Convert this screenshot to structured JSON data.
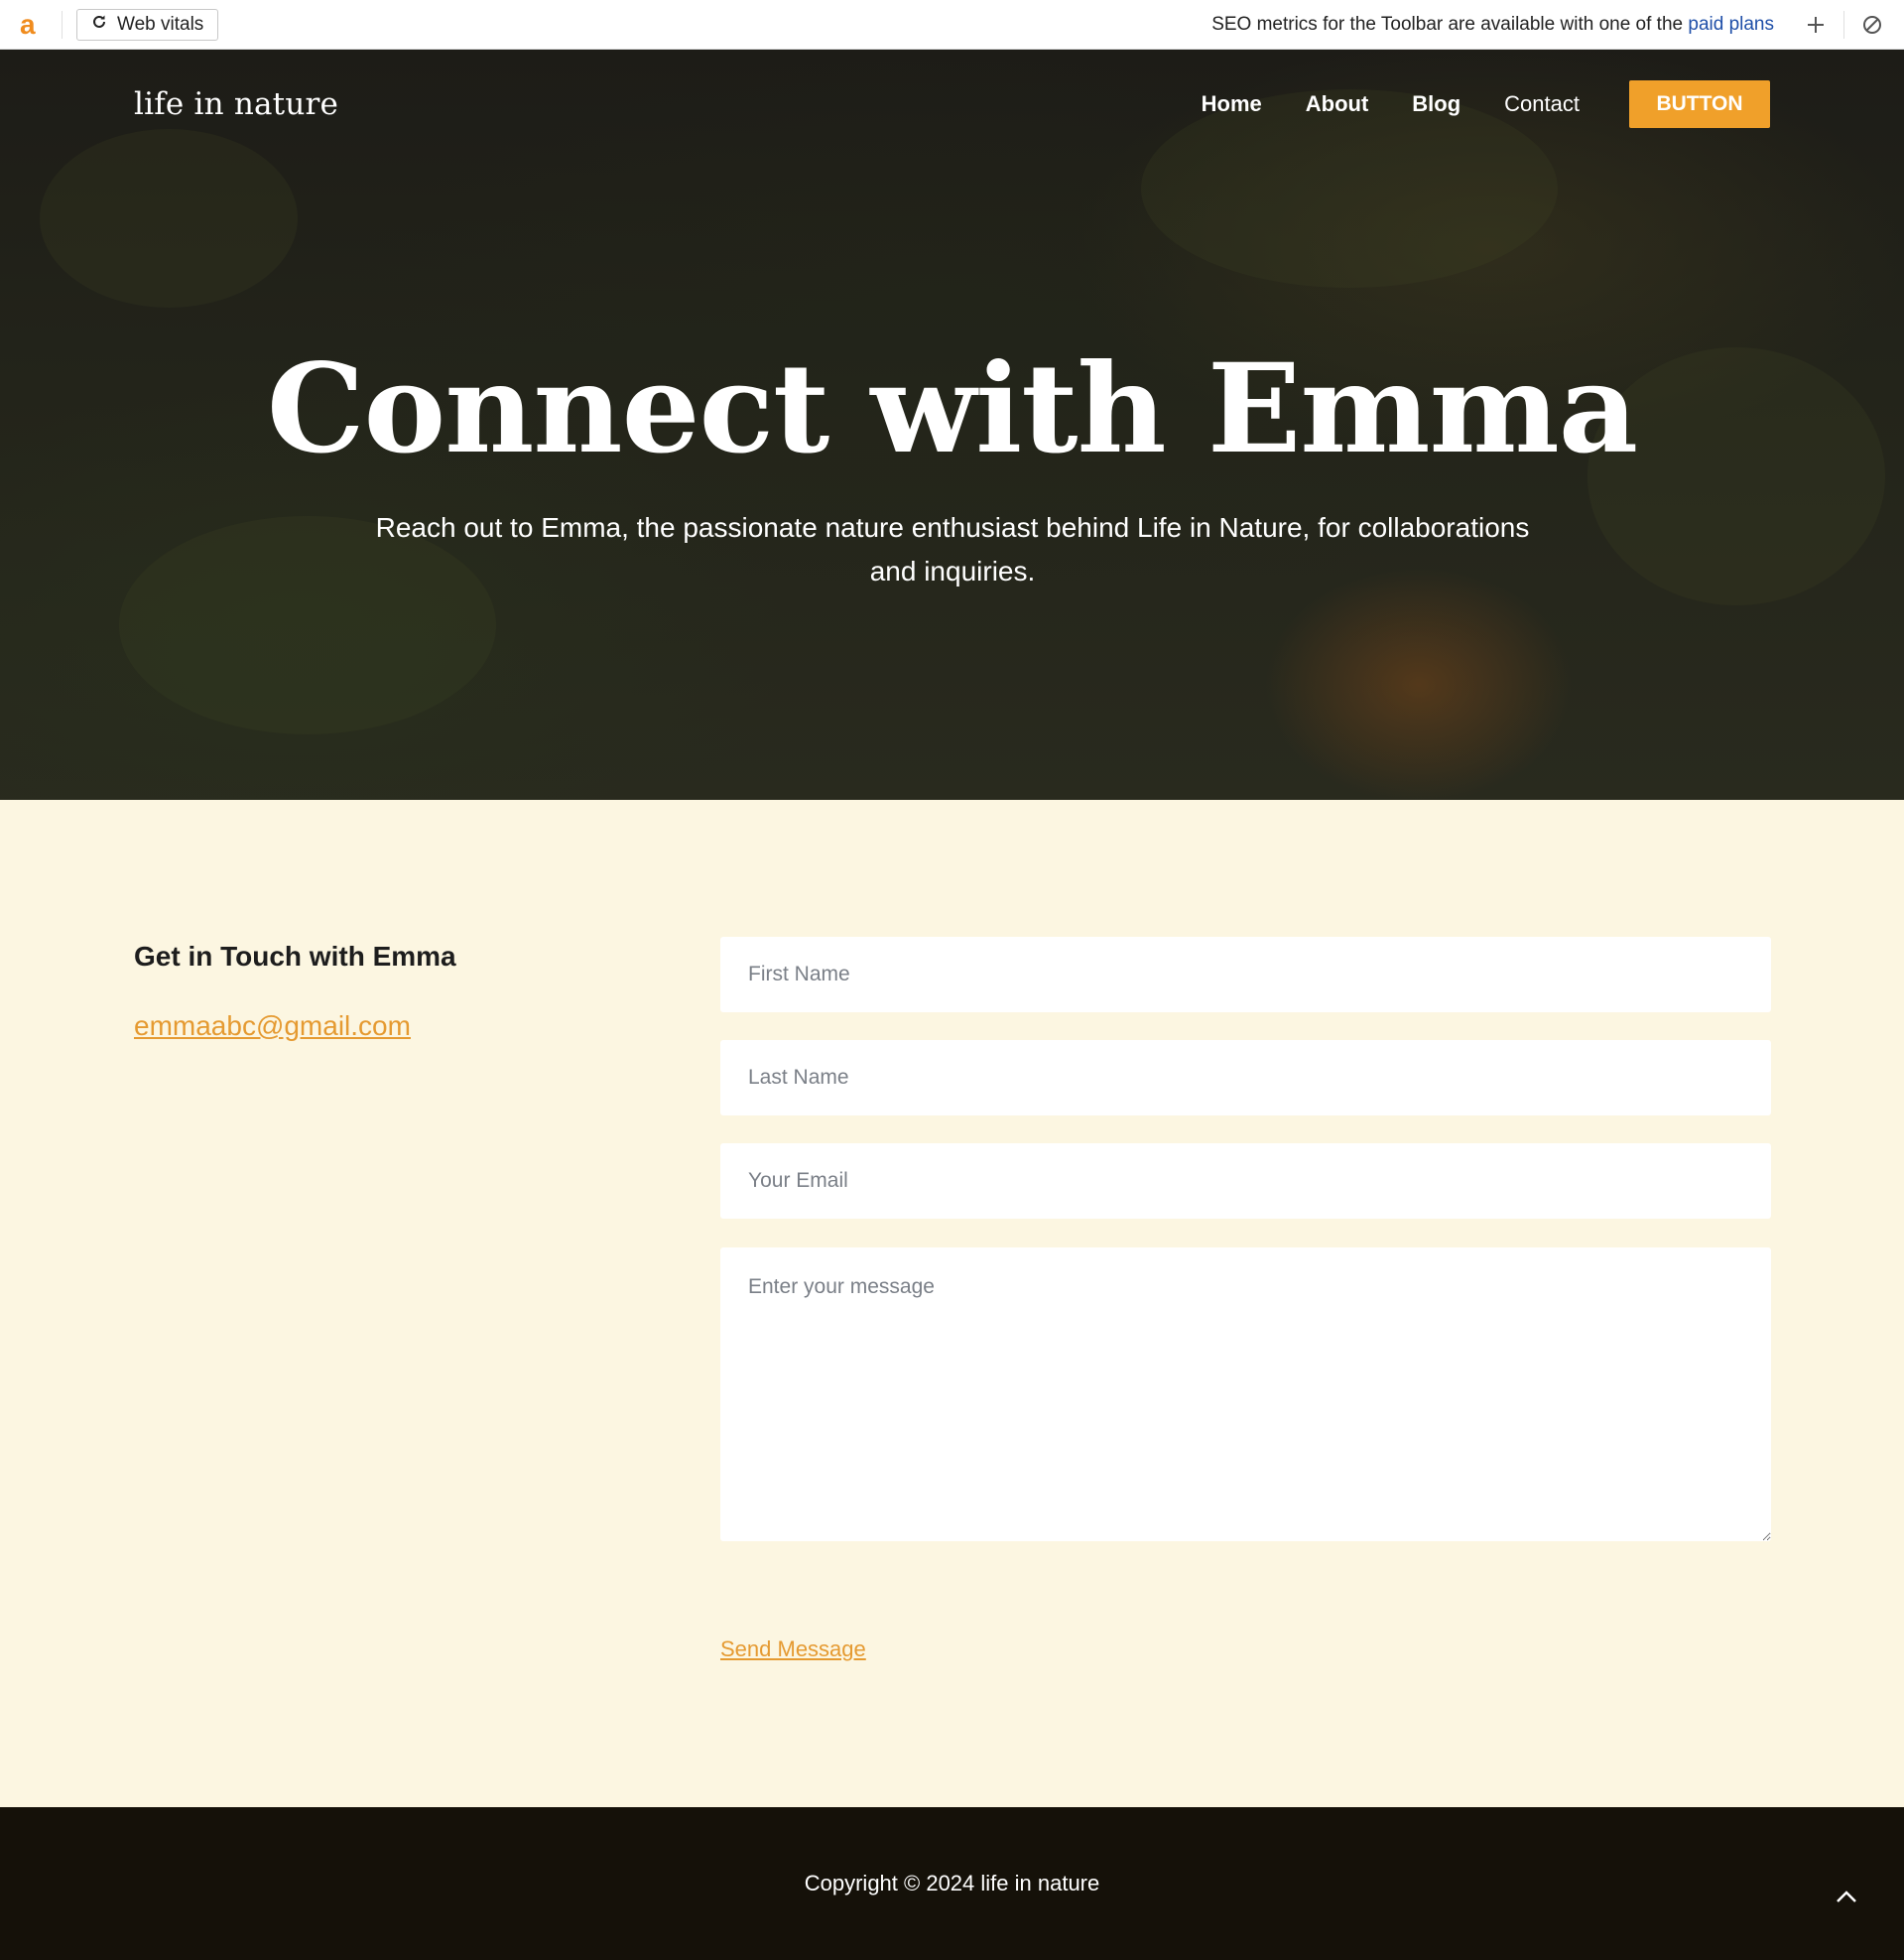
{
  "toolbar": {
    "logo": "a",
    "web_vitals_label": "Web vitals",
    "seo_message": "SEO metrics for the Toolbar are available with one of the ",
    "paid_plans_link": "paid plans"
  },
  "nav": {
    "brand": "life in nature",
    "links": [
      "Home",
      "About",
      "Blog",
      "Contact"
    ],
    "button_label": "BUTTON"
  },
  "hero": {
    "title": "Connect with Emma",
    "subtitle": "Reach out to Emma, the passionate nature enthusiast behind Life in Nature, for collaborations and inquiries."
  },
  "contact": {
    "heading": "Get in Touch with Emma",
    "email": "emmaabc@gmail.com",
    "form": {
      "first_name_placeholder": "First Name",
      "last_name_placeholder": "Last Name",
      "email_placeholder": "Your Email",
      "message_placeholder": "Enter your message",
      "submit_label": "Send Message"
    }
  },
  "footer": {
    "copyright": "Copyright © 2024 life in nature"
  },
  "colors": {
    "accent": "#f0a02a",
    "link": "#e59a31",
    "section_bg": "#fcf6e1",
    "footer_bg": "#151109"
  }
}
